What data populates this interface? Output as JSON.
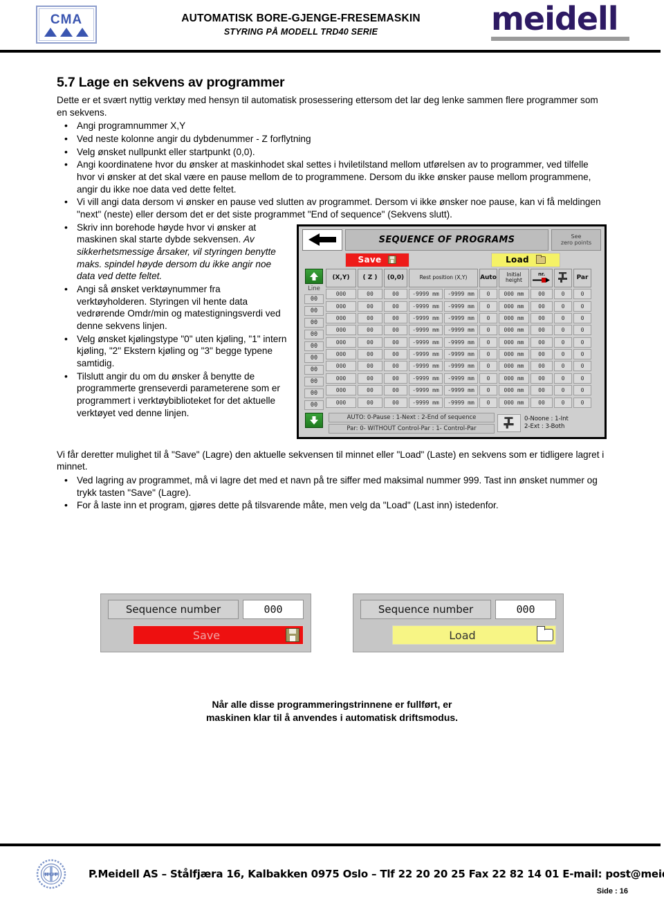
{
  "header": {
    "logo_text": "CMA",
    "title_line1": "AUTOMATISK BORE-GJENGE-FRESEMASKIN",
    "title_line2": "STYRING PÅ MODELL TRD40 SERIE",
    "brand": "meidell"
  },
  "section": {
    "heading": "5.7 Lage en sekvens av programmer",
    "intro": "Dette er et svært nyttig verktøy med hensyn til automatisk prosessering ettersom det lar deg lenke sammen flere programmer som en sekvens.",
    "bullets": [
      "Angi programnummer X,Y",
      "Ved neste kolonne angir du dybdenummer - Z forflytning",
      "Velg ønsket nullpunkt eller startpunkt (0,0).",
      "Angi koordinatene hvor du ønsker at maskinhodet skal settes i hviletilstand mellom utførelsen av to programmer, ved tilfelle hvor vi ønsker at det skal være en pause mellom de to programmene. Dersom du ikke ønsker pause mellom programmene, angir du ikke noe data ved dette feltet.",
      "Vi vill angi data dersom vi ønsker en pause ved slutten av programmet. Dersom vi ikke ønsker noe pause, kan vi få meldingen \"next\" (neste) eller dersom det er det siste programmet \"End of sequence\" (Sekvens slutt)."
    ],
    "bullet_mixed_1_plain": "Skriv inn borehode høyde hvor vi ønsker at maskinen skal starte dybde sekvensen. ",
    "bullet_mixed_1_italic": "Av sikkerhetsmessige årsaker, vil styringen benytte maks. spindel høyde dersom du ikke angir noe data ved dette feltet.",
    "bullets_after": [
      "Angi så ønsket verktøynummer fra verktøyholderen. Styringen vil hente data vedrørende Omdr/min og matestigningsverdi ved denne sekvens linjen.",
      "Velg ønsket kjølingstype \"0\" uten kjøling, \"1\" intern kjøling, \"2\" Ekstern kjøling og \"3\" begge typene samtidig.",
      "Tilslutt angir du om du ønsker å benytte de programmerte grenseverdi parameterene som er programmert i verktøybiblioteket for det aktuelle verktøyet ved denne linjen."
    ],
    "saveload_intro": "Vi får deretter mulighet til å \"Save\" (Lagre) den aktuelle sekvensen til minnet eller \"Load\" (Laste) en sekvens som er tidligere lagret i minnet.",
    "saveload_bullets": [
      "Ved lagring av programmet, må vi lagre det med et navn på tre siffer med maksimal nummer 999. Tast inn ønsket nummer og trykk tasten \"Save\" (Lagre).",
      "For å laste inn et program, gjøres dette på tilsvarende måte, men velg da \"Load\" (Last inn) istedenfor."
    ],
    "closing_line1": "Når alle disse programmeringstrinnene er fullført, er",
    "closing_line2": "maskinen  klar til å anvendes i automatisk driftsmodus."
  },
  "ui_panel": {
    "title": "SEQUENCE OF PROGRAMS",
    "back_icon": "back-arrow-icon",
    "zero_points_line1": "See",
    "zero_points_line2": "zero points",
    "save_label": "Save",
    "load_label": "Load",
    "save_icon": "floppy-disk-icon",
    "load_icon": "open-folder-icon",
    "up_icon": "arrow-up-icon",
    "down_icon": "arrow-down-icon",
    "line_label": "Line",
    "headers": [
      "(X,Y)",
      "( Z )",
      "(0,0)",
      "Rest position (X,Y)",
      "Auto",
      "Initial height",
      "nr.",
      "coolant",
      "Par"
    ],
    "header_initial_height_l1": "Initial",
    "header_initial_height_l2": "height",
    "header_nr": "nr.",
    "header_par": "Par",
    "row_template": {
      "line": "00",
      "xy": "000",
      "z": "00",
      "zero": "00",
      "rest_x": "-9999 mm",
      "rest_y": "-9999 mm",
      "auto": "0",
      "initial_height": "000 mm",
      "nr": "00",
      "coolant": "0",
      "par": "0"
    },
    "row_count": 10,
    "legend_line1": "AUTO: 0-Pause : 1-Next : 2-End of sequence",
    "legend_line2": "Par: 0- WITHOUT Control-Par : 1- Control-Par",
    "coolant_legend_line1": "0-Noone : 1-Int",
    "coolant_legend_line2": "2-Ext : 3-Both"
  },
  "save_widget": {
    "label": "Sequence number",
    "value": "000",
    "button": "Save",
    "icon": "floppy-disk-icon"
  },
  "load_widget": {
    "label": "Sequence number",
    "value": "000",
    "button": "Load",
    "icon": "open-folder-icon"
  },
  "footer": {
    "seal_text": "HGF",
    "contact": "P.Meidell AS – Stålfjæra 16, Kalbakken 0975 Oslo – Tlf 22 20 20 25  Fax 22 82 14 01  E-mail: post@meidell.no",
    "page": "Side : 16"
  },
  "colors": {
    "save_red": "#ee1b19",
    "load_yellow": "#f5f266",
    "green_button": "#2d8f2d",
    "brand_purple": "#2d1a63",
    "panel_gray": "#cfcfcf"
  }
}
